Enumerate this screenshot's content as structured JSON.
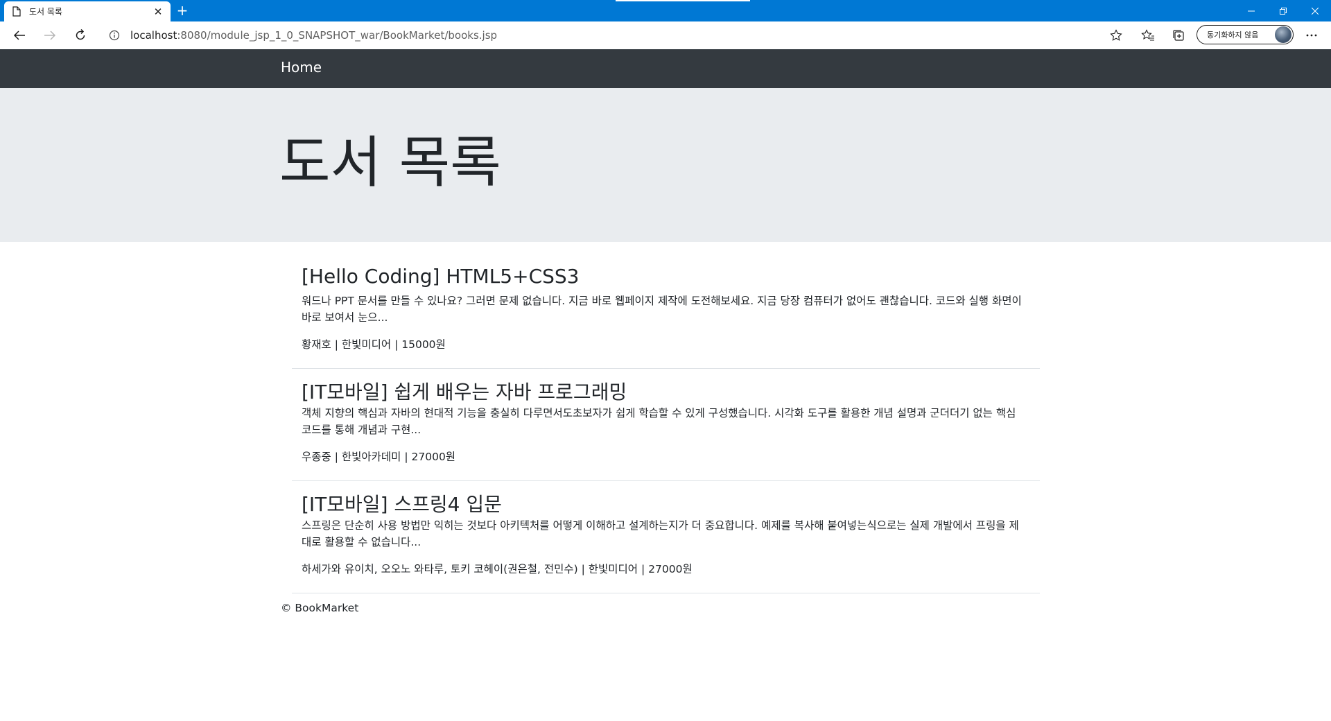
{
  "browser": {
    "tab": {
      "title": "도서 목록"
    },
    "address": {
      "host": "localhost",
      "path": ":8080/module_jsp_1_0_SNAPSHOT_war/BookMarket/books.jsp"
    },
    "profile": {
      "sync_status": "동기화하지 않음"
    }
  },
  "navbar": {
    "brand": "Home"
  },
  "jumbotron": {
    "title": "도서 목록"
  },
  "books": [
    {
      "title": "[Hello Coding] HTML5+CSS3",
      "description": "워드나 PPT 문서를 만들 수 있나요? 그러면 문제 없습니다. 지금 바로 웹페이지 제작에 도전해보세요. 지금 당장 컴퓨터가 없어도 괜찮습니다. 코드와 실행 화면이 바로 보여서 눈으...",
      "meta": "황재호 | 한빛미디어 | 15000원"
    },
    {
      "title": "[IT모바일] 쉽게 배우는 자바 프로그래밍",
      "description": "객체 지향의 핵심과 자바의 현대적 기능을 충실히 다루면서도초보자가 쉽게 학습할 수 있게 구성했습니다. 시각화 도구를 활용한 개념 설명과 군더더기 없는 핵심 코드를 통해 개념과 구현...",
      "meta": "우종중 | 한빛아카데미 | 27000원"
    },
    {
      "title": "[IT모바일] 스프링4 입문",
      "description": "스프링은 단순히 사용 방법만 익히는 것보다 아키텍처를 어떻게 이해하고 설계하는지가 더 중요합니다. 예제를 복사해 붙여넣는식으로는 실제 개발에서 프링을 제대로 활용할 수 없습니다...",
      "meta": "하세가와 유이치, 오오노 와타루, 토키 코헤이(권은철, 전민수) | 한빛미디어 | 27000원"
    }
  ],
  "footer": {
    "copyright": "© BookMarket"
  },
  "colors": {
    "tabbar": "#0078d4",
    "navbar": "#343a40",
    "jumbotron": "#e9ecef",
    "divider": "#dee2e6"
  }
}
